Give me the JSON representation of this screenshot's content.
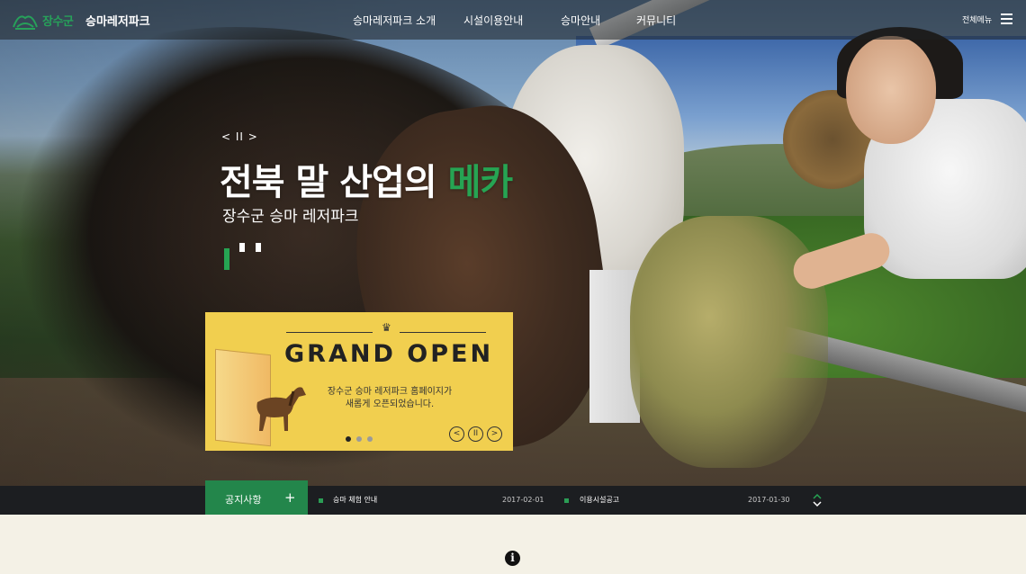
{
  "header": {
    "logo_text": "장수군",
    "site_name": "승마레저파크",
    "nav": [
      "승마레저파크 소개",
      "시설이용안내",
      "승마안내",
      "커뮤니티"
    ],
    "all_menu": "전체메뉴"
  },
  "hero": {
    "slide_control": "< II >",
    "headline_main": "전북 말 산업의 ",
    "headline_accent": "메카",
    "subline": "장수군 승마 레저파크"
  },
  "popup": {
    "title": "GRAND OPEN",
    "message_line1": "장수군 승마 레저파크 홈페이지가",
    "message_line2": "새롭게 오픈되었습니다.",
    "prev": "<",
    "pause": "II",
    "next": ">",
    "active_slide": 1,
    "slide_count": 3
  },
  "notice": {
    "tab_title": "공지사항",
    "plus": "+",
    "items": [
      {
        "title": "승마 체험 안내",
        "date": "2017-02-01"
      },
      {
        "title": "이용시설공고",
        "date": "2017-01-30"
      }
    ]
  },
  "colors": {
    "accent_green": "#26a453",
    "notice_green": "#23864b",
    "popup_yellow": "#f1cf4f"
  },
  "icons": [
    "logo-icon",
    "menu-icon",
    "crown-icon",
    "info-icon",
    "scroll-arrows-icon"
  ]
}
